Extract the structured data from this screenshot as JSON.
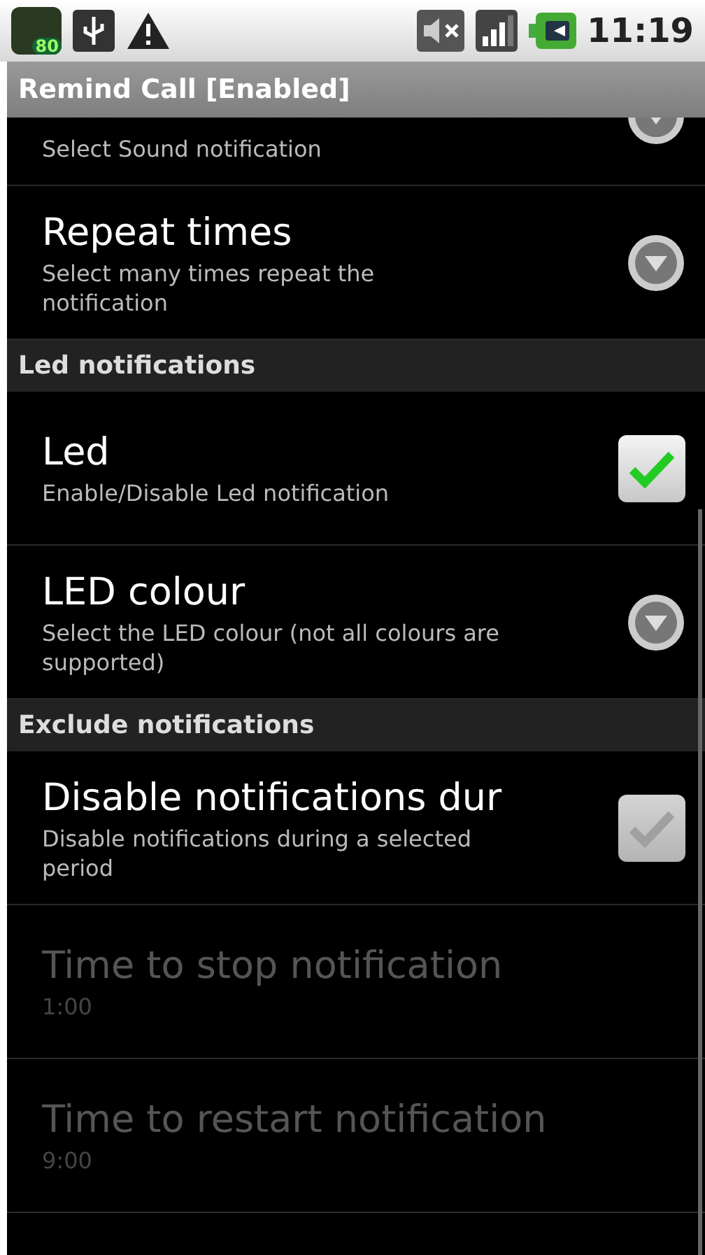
{
  "status_bar": {
    "battery_badge": "80",
    "time": "11:19"
  },
  "title_bar": {
    "title": "Remind Call [Enabled]"
  },
  "items": [
    {
      "kind": "list",
      "summary": "Select Sound notification",
      "disabled": false,
      "partial": true
    },
    {
      "kind": "list",
      "title": "Repeat times",
      "summary": "Select many times repeat the notification",
      "disabled": false
    },
    {
      "kind": "header",
      "title": "Led notifications"
    },
    {
      "kind": "checkbox",
      "title": "Led",
      "summary": "Enable/Disable Led notification",
      "checked": true,
      "disabled": false
    },
    {
      "kind": "list",
      "title": "LED colour",
      "summary": "Select the LED colour (not all colours are supported)",
      "disabled": false
    },
    {
      "kind": "header",
      "title": "Exclude notifications"
    },
    {
      "kind": "checkbox",
      "title": "Disable notifications dur",
      "summary": "Disable notifications during a selected period",
      "checked": false,
      "disabled": false
    },
    {
      "kind": "plain",
      "title": "Time to stop notification",
      "summary": "1:00",
      "disabled": true
    },
    {
      "kind": "plain",
      "title": "Time to restart notification",
      "summary": "9:00",
      "disabled": true
    }
  ]
}
